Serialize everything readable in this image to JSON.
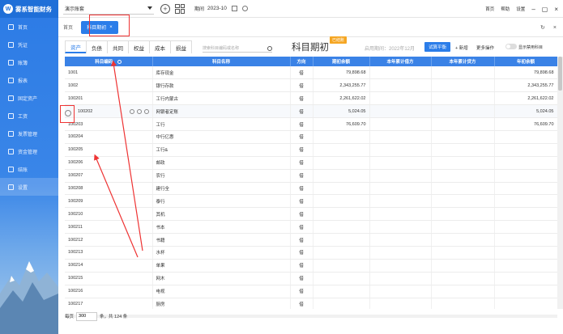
{
  "app": {
    "logo_text": "雾系智能财务"
  },
  "sidebar": {
    "items": [
      {
        "label": "首页"
      },
      {
        "label": "凭证"
      },
      {
        "label": "账簿"
      },
      {
        "label": "报表"
      },
      {
        "label": "固定资产"
      },
      {
        "label": "工资"
      },
      {
        "label": "发票管理"
      },
      {
        "label": "资金管理"
      },
      {
        "label": "结账"
      },
      {
        "label": "设置"
      }
    ]
  },
  "topbar": {
    "account": "演示账套",
    "period_label": "期间",
    "period_value": "2023-10",
    "links": [
      "首页",
      "帮助",
      "设置"
    ]
  },
  "tabs": {
    "home": "首页",
    "current": "科目期初",
    "close": "×"
  },
  "categories": [
    "资产",
    "负债",
    "共同",
    "权益",
    "成本",
    "损益"
  ],
  "search": {
    "placeholder": "搜索科目编码或名称"
  },
  "title": "科目期初",
  "badge": "已结账",
  "period_info": "启用期间：2022年12月",
  "buttons": {
    "trial": "试算平衡",
    "add": "+ 新增",
    "more": "更多操作",
    "toggle_label": "显示禁用科目"
  },
  "table": {
    "headers": [
      "科目编码",
      "科目名称",
      "方向",
      "期初余额",
      "本年累计借方",
      "本年累计贷方",
      "年初余额"
    ],
    "rows": [
      [
        "1001",
        "库存现金",
        "借",
        "79,898.68",
        "",
        "",
        "79,898.68"
      ],
      [
        "1002",
        "银行存款",
        "借",
        "2,343,255.77",
        "",
        "",
        "2,343,255.77"
      ],
      [
        "100201",
        "工行内蒙古",
        "借",
        "2,261,622.02",
        "",
        "",
        "2,261,622.02"
      ],
      [
        "100202",
        "网银者定账",
        "借",
        "5,024.05",
        "",
        "",
        "5,024.05"
      ],
      [
        "100203",
        "工行",
        "借",
        "76,609.70",
        "",
        "",
        "76,609.70"
      ],
      [
        "100204",
        "中行亿惠",
        "借",
        "",
        "",
        "",
        ""
      ],
      [
        "100205",
        "工行&",
        "借",
        "",
        "",
        "",
        ""
      ],
      [
        "100206",
        "邮政",
        "借",
        "",
        "",
        "",
        ""
      ],
      [
        "100207",
        "农行",
        "借",
        "",
        "",
        "",
        ""
      ],
      [
        "100208",
        "建行全",
        "借",
        "",
        "",
        "",
        ""
      ],
      [
        "100209",
        "泰行",
        "借",
        "",
        "",
        "",
        ""
      ],
      [
        "100210",
        "其机",
        "借",
        "",
        "",
        "",
        ""
      ],
      [
        "100211",
        "书本",
        "借",
        "",
        "",
        "",
        ""
      ],
      [
        "100212",
        "书籍",
        "借",
        "",
        "",
        "",
        ""
      ],
      [
        "100213",
        "水杯",
        "借",
        "",
        "",
        "",
        ""
      ],
      [
        "100214",
        "单果",
        "借",
        "",
        "",
        "",
        ""
      ],
      [
        "100215",
        "网木",
        "借",
        "",
        "",
        "",
        ""
      ],
      [
        "100216",
        "电视",
        "借",
        "",
        "",
        "",
        ""
      ],
      [
        "100217",
        "厨房",
        "借",
        "",
        "",
        "",
        ""
      ]
    ]
  },
  "footer": {
    "prefix": "每页",
    "page_size": "300",
    "suffix": "条，共 124 条"
  },
  "colors": {
    "primary": "#2b7de9",
    "header": "#3a82e6",
    "badge": "#f5a623",
    "annotation": "#e33333"
  }
}
